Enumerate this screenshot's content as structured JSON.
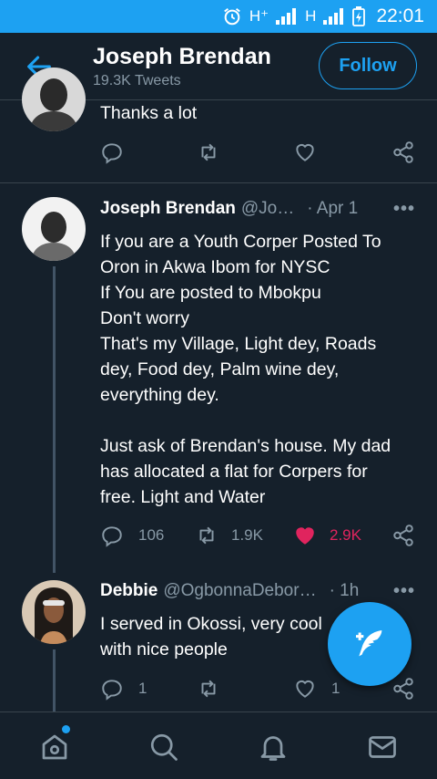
{
  "status_bar": {
    "network_1": "H⁺",
    "network_2": "H",
    "time": "22:01"
  },
  "header": {
    "title": "Joseph Brendan",
    "subtitle": "19.3K Tweets",
    "follow_label": "Follow"
  },
  "tweets": [
    {
      "text": "Thanks a lot",
      "actions": {
        "replies": "",
        "retweets": "",
        "likes": ""
      }
    },
    {
      "display_name": "Joseph Brendan",
      "handle": "@Jo…",
      "date": "· Apr 1",
      "text": "If you are a Youth Corper Posted To\nOron in Akwa Ibom for NYSC\nIf You are posted to Mbokpu\nDon't worry\nThat's my Village, Light dey, Roads\ndey, Food dey, Palm wine dey,\neverything dey.\n\nJust ask of Brendan's house. My dad\nhas allocated a flat for Corpers for\nfree. Light and Water",
      "actions": {
        "replies": "106",
        "retweets": "1.9K",
        "likes": "2.9K"
      },
      "liked": true
    },
    {
      "display_name": "Debbie",
      "handle": "@OgbonnaDebor…",
      "date": "· 1h",
      "text": "I served in Okossi, very cool\nwith nice people",
      "actions": {
        "replies": "1",
        "retweets": "",
        "likes": "1"
      }
    }
  ],
  "colors": {
    "accent": "#1da1f2",
    "background": "#15202b",
    "liked": "#e0245e",
    "muted": "#8899a6"
  },
  "icons": {
    "back": "arrow-left-icon",
    "reply": "reply-icon",
    "retweet": "retweet-icon",
    "like": "heart-icon",
    "share": "share-icon",
    "compose": "compose-feather-icon",
    "home": "home-icon",
    "search": "search-icon",
    "notifications": "bell-icon",
    "messages": "mail-icon"
  }
}
